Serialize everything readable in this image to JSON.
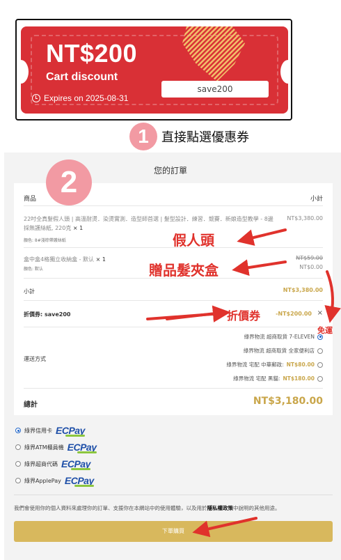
{
  "coupon": {
    "amount": "NT$200",
    "label": "Cart discount",
    "expires": "Expires on 2025-08-31",
    "code": "save200",
    "icon": "clock-icon",
    "color": "#d93036"
  },
  "steps": {
    "step1_number": "1",
    "step1_text": "直接點選優惠券",
    "step2_number": "2"
  },
  "order": {
    "title": "您的訂單",
    "headers": {
      "product": "商品",
      "subtotal": "小計"
    },
    "items": [
      {
        "name": "22吋全真髮假人頭 | 高溫耐燙．染燙實測．造型師首選 | 髮型設計．練習．競賽．新娘造型教學 - 8邊採無護絲紙, 220克",
        "qty": "× 1",
        "meta": "顏色: 8#淺棕帶護絲紙",
        "price": "NT$3,380.00"
      },
      {
        "name": "盒中盒4格獨立收納盒 - 默认",
        "qty": "× 1",
        "meta": "顏色: 默认",
        "price_original": "NT$59.00",
        "price": "NT$0.00"
      }
    ],
    "subtotal_label": "小計",
    "subtotal_value": "NT$3,380.00",
    "discount_label": "折價券: save200",
    "discount_value": "-NT$200.00",
    "discount_remove": "×",
    "shipping_label": "運送方式",
    "shipping_options": [
      {
        "label": "綠界物流 超商取貨 7-ELEVEN",
        "price": "",
        "selected": true
      },
      {
        "label": "綠界物流 超商取貨 全家便利店",
        "price": "",
        "selected": false
      },
      {
        "label": "綠界物流 宅配 中華郵政:",
        "price": "NT$80.00",
        "selected": false
      },
      {
        "label": "綠界物流 宅配 黑貓:",
        "price": "NT$180.00",
        "selected": false
      }
    ],
    "total_label": "總計",
    "total_value": "NT$3,180.00"
  },
  "payments": [
    {
      "label": "綠界信用卡",
      "selected": true,
      "brand": "ECPay"
    },
    {
      "label": "綠界ATM櫃員機",
      "selected": false,
      "brand": "ECPay"
    },
    {
      "label": "綠界超商代碼",
      "selected": false,
      "brand": "ECPay"
    },
    {
      "label": "綠界ApplePay",
      "selected": false,
      "brand": "ECPay"
    }
  ],
  "policy": {
    "text_before": "我們會使用你的個人資料來處理你的訂單、支援你在本網站中的使用體驗，以及用於",
    "link": "隱私權政策",
    "text_after": "中說明的其他用途。"
  },
  "submit_label": "下單購買",
  "annotations": {
    "wig": "假人頭",
    "gift": "贈品髮夾盒",
    "coupon": "折價券",
    "free_shipping": "免運"
  },
  "colors": {
    "accent_gold": "#c9a64a",
    "button_gold": "#d8b85d",
    "annotation_red": "#e0322c",
    "badge_pink": "#f29aa3",
    "ecpay_blue": "#1e4fa8"
  }
}
